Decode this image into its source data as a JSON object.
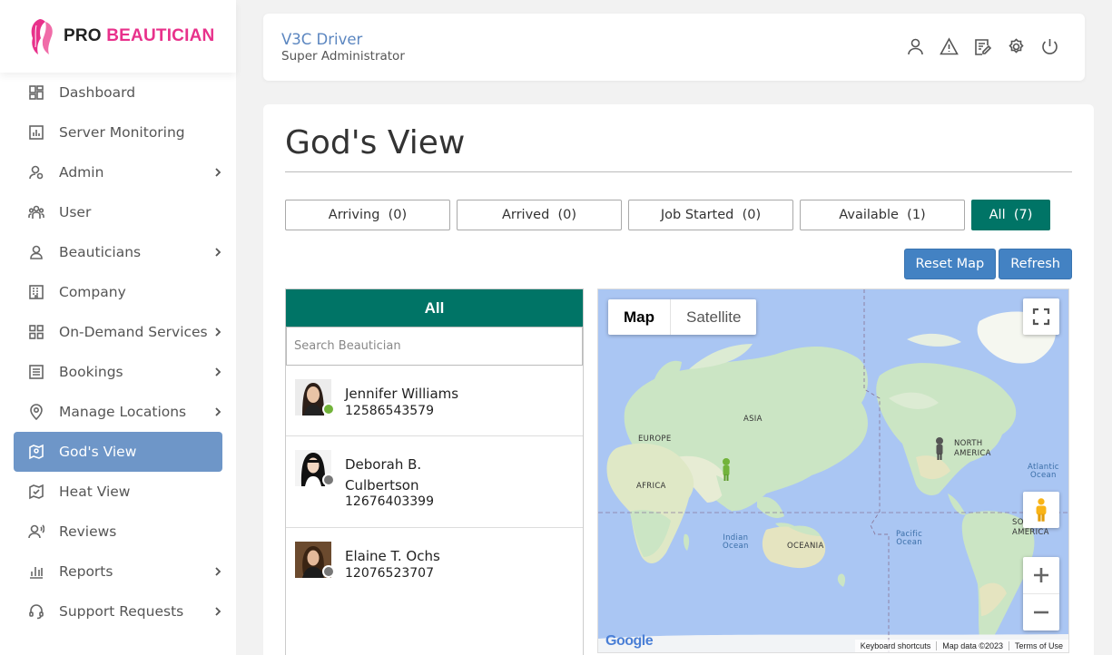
{
  "brand": {
    "name_part1": "PRO",
    "name_part2": "BEAUTICIAN",
    "accent_color": "#e8318b"
  },
  "sidebar": {
    "items": [
      {
        "label": "Dashboard",
        "icon": "dashboard-icon",
        "has_submenu": false
      },
      {
        "label": "Server Monitoring",
        "icon": "monitor-chart-icon",
        "has_submenu": false
      },
      {
        "label": "Admin",
        "icon": "admin-user-icon",
        "has_submenu": true
      },
      {
        "label": "User",
        "icon": "users-icon",
        "has_submenu": false
      },
      {
        "label": "Beauticians",
        "icon": "beautician-icon",
        "has_submenu": true
      },
      {
        "label": "Company",
        "icon": "building-icon",
        "has_submenu": false
      },
      {
        "label": "On-Demand Services",
        "icon": "grid-icon",
        "has_submenu": true
      },
      {
        "label": "Bookings",
        "icon": "list-icon",
        "has_submenu": true
      },
      {
        "label": "Manage Locations",
        "icon": "location-pin-icon",
        "has_submenu": true
      },
      {
        "label": "God's View",
        "icon": "map-view-icon",
        "has_submenu": false,
        "active": true
      },
      {
        "label": "Heat View",
        "icon": "heat-map-icon",
        "has_submenu": false
      },
      {
        "label": "Reviews",
        "icon": "reviews-icon",
        "has_submenu": false
      },
      {
        "label": "Reports",
        "icon": "bar-chart-icon",
        "has_submenu": true
      },
      {
        "label": "Support Requests",
        "icon": "headset-icon",
        "has_submenu": true
      }
    ],
    "active_color": "#6e96c8"
  },
  "header": {
    "user_name": "V3C Driver",
    "user_role": "Super Administrator",
    "icons": [
      "profile-icon",
      "alert-icon",
      "notes-icon",
      "settings-icon",
      "power-icon"
    ]
  },
  "main": {
    "title": "God's View",
    "filters": [
      {
        "label": "Arriving",
        "count": "(0)"
      },
      {
        "label": "Arrived",
        "count": "(0)"
      },
      {
        "label": "Job Started",
        "count": "(0)"
      },
      {
        "label": "Available",
        "count": "(1)"
      },
      {
        "label": "All",
        "count": "(7)",
        "selected": true
      }
    ],
    "buttons": {
      "reset": "Reset Map",
      "refresh": "Refresh"
    },
    "accent_color": "#007466",
    "button_color": "#4382c3"
  },
  "list": {
    "heading": "All",
    "search_placeholder": "Search Beautician",
    "beauticians": [
      {
        "name": "Jennifer Williams",
        "phone": "12586543579",
        "status_color": "#72b33a"
      },
      {
        "name": "Deborah B. Culbertson",
        "phone": "12676403399",
        "status_color": "#777777"
      },
      {
        "name": "Elaine T. Ochs",
        "phone": "12076523707",
        "status_color": "#777777"
      }
    ]
  },
  "map": {
    "tabs": {
      "map": "Map",
      "satellite": "Satellite"
    },
    "labels": {
      "asia": "ASIA",
      "europe": "EUROPE",
      "africa": "AFRICA",
      "oceania": "OCEANIA",
      "north_america_1": "NORTH",
      "north_america_2": "AMERICA",
      "south_america_1": "SO",
      "south_america_2": "AMERICA",
      "indian_ocean_1": "Indian",
      "indian_ocean_2": "Ocean",
      "pacific_ocean_1": "Pacific",
      "pacific_ocean_2": "Ocean",
      "atlantic_ocean_1": "Atlantic",
      "atlantic_ocean_2": "Ocean"
    },
    "attribution": {
      "shortcuts": "Keyboard shortcuts",
      "data": "Map data ©2023",
      "terms": "Terms of Use"
    },
    "logo": "Google",
    "water_color": "#aac6f3",
    "land_color": "#cbe5c4"
  }
}
